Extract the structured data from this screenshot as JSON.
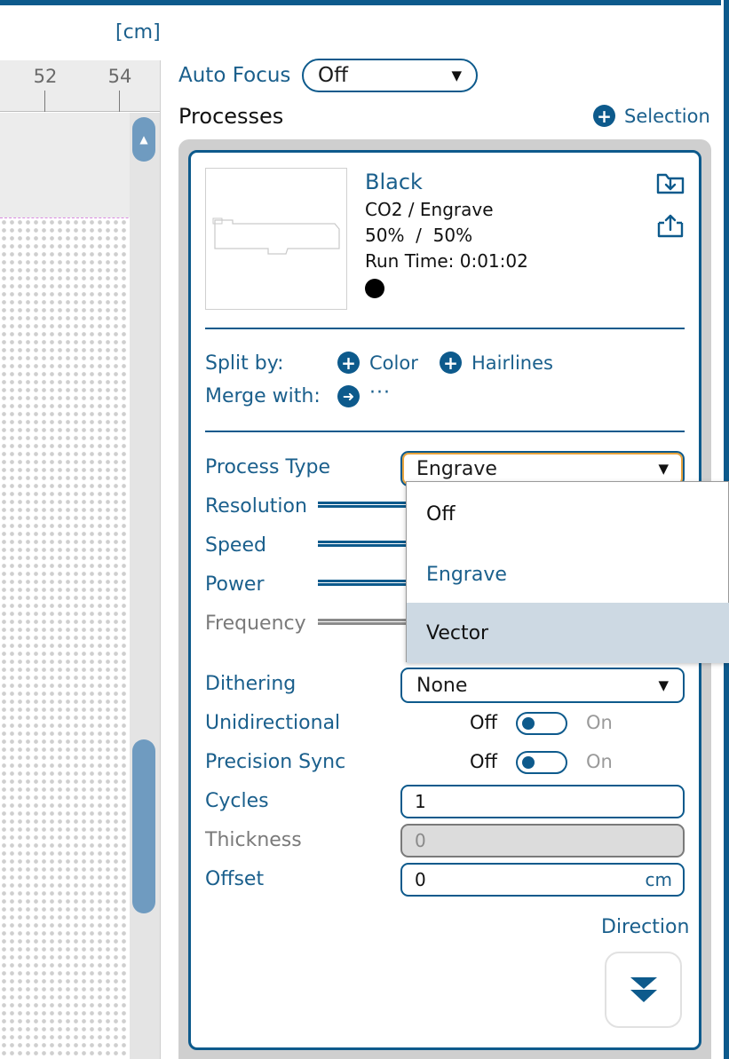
{
  "ruler": {
    "unit": "[cm]",
    "labels": [
      "52",
      "54"
    ]
  },
  "auto_focus": {
    "label": "Auto Focus",
    "value": "Off"
  },
  "processes": {
    "title": "Processes",
    "selection_label": "Selection"
  },
  "process_card": {
    "name": "Black",
    "laser_mode": "CO2 / Engrave",
    "power_speed": "50%  /  50%",
    "run_time": "Run Time: 0:01:02",
    "color": "#000000",
    "split_by_label": "Split by:",
    "split_color_label": "Color",
    "split_hairlines_label": "Hairlines",
    "merge_with_label": "Merge with:",
    "merge_value": "···"
  },
  "settings": {
    "process_type_label": "Process Type",
    "process_type_value": "Engrave",
    "resolution_label": "Resolution",
    "speed_label": "Speed",
    "power_label": "Power",
    "frequency_label": "Frequency",
    "dithering_label": "Dithering",
    "dithering_value": "None",
    "unidirectional_label": "Unidirectional",
    "precision_sync_label": "Precision Sync",
    "toggle_off": "Off",
    "toggle_on": "On",
    "cycles_label": "Cycles",
    "cycles_value": "1",
    "thickness_label": "Thickness",
    "thickness_value": "0",
    "offset_label": "Offset",
    "offset_value": "0",
    "offset_unit": "cm",
    "direction_label": "Direction"
  },
  "process_type_dropdown": {
    "options": [
      "Off",
      "Engrave",
      "Vector"
    ]
  },
  "colors": {
    "accent": "#0d5a8c",
    "label_blue": "#1a5f8c",
    "hover": "#cdd9e3",
    "focus_ring": "#e8a33c"
  }
}
